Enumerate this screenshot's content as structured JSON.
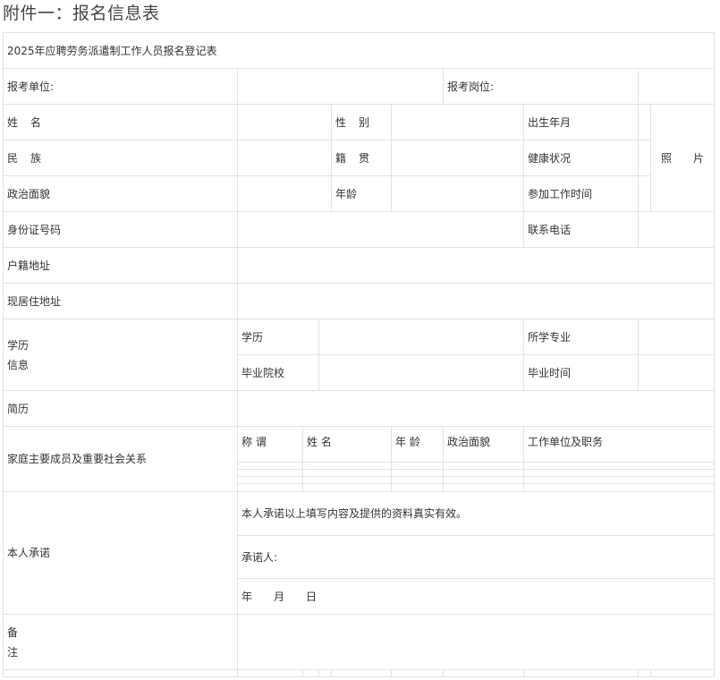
{
  "page": {
    "heading": "附件一：报名信息表"
  },
  "form": {
    "title": "2025年应聘劳务派遣制工作人员报名登记表",
    "applying_unit_label": "报考单位:",
    "applying_post_label": "报考岗位:",
    "name_label_a": "姓",
    "name_label_b": "名",
    "gender_label_a": "性",
    "gender_label_b": "别",
    "birth_label": "出生年月",
    "photo_label_a": "照",
    "photo_label_b": "片",
    "ethnicity_label_a": "民",
    "ethnicity_label_b": "族",
    "native_place_label_a": "籍",
    "native_place_label_b": "贯",
    "health_label": "健康状况",
    "political_label": "政治面貌",
    "age_label": "年龄",
    "work_start_label": "参加工作时间",
    "id_number_label": "身份证号码",
    "phone_label": "联系电话",
    "household_address_label": "户籍地址",
    "current_address_label": "现居住地址",
    "education_section_line1": "学历",
    "education_section_line2": "信息",
    "degree_label": "学历",
    "major_label": "所学专业",
    "school_label": "毕业院校",
    "graduation_time_label": "毕业时间",
    "resume_label": "简历",
    "family_label": "家庭主要成员及重要社会关系",
    "family_headers": {
      "relation": "称 谓",
      "name": "姓 名",
      "age": "年 龄",
      "political": "政治面貌",
      "work": "工作单位及职务"
    },
    "pledge_label": "本人承诺",
    "pledge_text": "本人承诺以上填写内容及提供的资料真实有效。",
    "pledger_label": "承诺人:",
    "date_year": "年",
    "date_month": "月",
    "date_day": "日",
    "remarks_line1": "备",
    "remarks_line2": "注"
  }
}
